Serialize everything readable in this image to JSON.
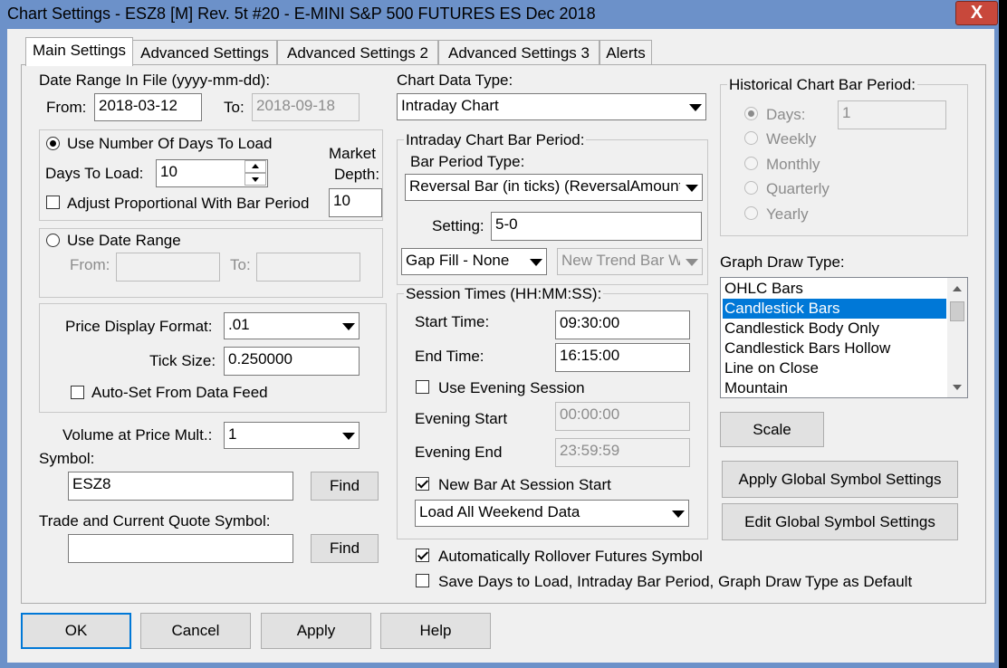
{
  "window": {
    "title": "Chart Settings - ESZ8 [M]  Rev. 5t  #20 - E-MINI S&P 500 FUTURES ES Dec 2018",
    "close": "X"
  },
  "tabs": [
    "Main Settings",
    "Advanced Settings",
    "Advanced Settings 2",
    "Advanced Settings 3",
    "Alerts"
  ],
  "date_range": {
    "label": "Date Range In File (yyyy-mm-dd):",
    "from_label": "From:",
    "from": "2018-03-12",
    "to_label": "To:",
    "to": "2018-09-18"
  },
  "days": {
    "use_days_label": "Use Number Of Days To Load",
    "days_label": "Days To Load:",
    "days_value": "10",
    "market_label_1": "Market",
    "market_label_2": "Depth:",
    "market_depth": "10",
    "adjust_label": "Adjust Proportional With Bar Period"
  },
  "date_range_option": {
    "label": "Use Date Range",
    "from_label": "From:",
    "to_label": "To:"
  },
  "price": {
    "format_label": "Price Display Format:",
    "format_value": ".01",
    "tick_label": "Tick Size:",
    "tick_value": "0.250000",
    "autoset_label": "Auto-Set From Data Feed"
  },
  "volume": {
    "label": "Volume at Price Mult.:",
    "value": "1"
  },
  "symbol": {
    "label": "Symbol:",
    "value": "ESZ8",
    "find": "Find",
    "trade_label": "Trade and Current Quote Symbol:",
    "trade_value": "",
    "find2": "Find"
  },
  "chart_data_type": {
    "label": "Chart Data Type:",
    "value": "Intraday Chart"
  },
  "intraday": {
    "group": "Intraday Chart Bar Period:",
    "bar_type_label": "Bar Period Type:",
    "bar_type_value": "Reversal Bar (in ticks) (ReversalAmount)",
    "setting_label": "Setting:",
    "setting_value": "5-0",
    "gap_value": "Gap Fill - None",
    "new_trend_value": "New Trend Bar With"
  },
  "session": {
    "group": "Session Times (HH:MM:SS):",
    "start_label": "Start Time:",
    "start_value": "09:30:00",
    "end_label": "End Time:",
    "end_value": "16:15:00",
    "use_evening_label": "Use Evening Session",
    "evening_start_label": "Evening Start",
    "evening_start_value": "00:00:00",
    "evening_end_label": "Evening End",
    "evening_end_value": "23:59:59",
    "new_bar_label": "New Bar At Session Start",
    "weekend_value": "Load All Weekend Data"
  },
  "rollover": {
    "auto_label": "Automatically Rollover Futures Symbol",
    "save_label": "Save Days to Load, Intraday Bar Period, Graph Draw Type as Default"
  },
  "historical": {
    "group": "Historical Chart Bar Period:",
    "days_label": "Days:",
    "days_value": "1",
    "weekly": "Weekly",
    "monthly": "Monthly",
    "quarterly": "Quarterly",
    "yearly": "Yearly"
  },
  "graph_draw": {
    "label": "Graph Draw Type:",
    "items": [
      "OHLC Bars",
      "Candlestick Bars",
      "Candlestick Body Only",
      "Candlestick Bars Hollow",
      "Line on Close",
      "Mountain"
    ],
    "selected_index": 1
  },
  "buttons": {
    "scale": "Scale",
    "apply_global": "Apply Global Symbol Settings",
    "edit_global": "Edit Global Symbol Settings",
    "ok": "OK",
    "cancel": "Cancel",
    "apply": "Apply",
    "help": "Help"
  },
  "colors": {
    "title_bar": "#6c91c9",
    "selection": "#0078d7",
    "close_button": "#c8483b"
  }
}
